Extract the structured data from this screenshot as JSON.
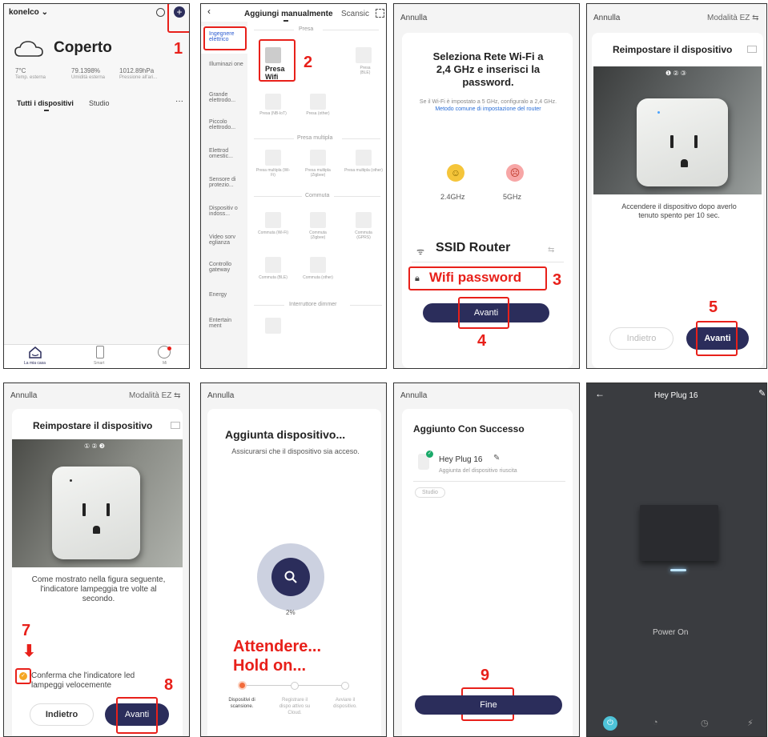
{
  "p1": {
    "user": "konelco ⌄",
    "weather": "Coperto",
    "temp": "7°C",
    "temp_lbl": "Temp. esterna",
    "hum": "79.1398%",
    "hum_lbl": "Umidità esterna",
    "press": "1012.89hPa",
    "press_lbl": "Pressione all'ari...",
    "tab_all": "Tutti i dispositivi",
    "tab_studio": "Studio",
    "more": "···",
    "nav": [
      "La mia casa",
      "Smart",
      "Mi"
    ],
    "step": "1"
  },
  "p2": {
    "title": "Aggiungi manualmente",
    "scan": "Scansic",
    "cats": [
      "Ingegnere elettrico",
      "Illuminazi one",
      "Grande elettrodo...",
      "Piccolo elettrodo...",
      "Elettrod omestic...",
      "Sensore di protezio...",
      "Dispositiv o indoss...",
      "Video sorv eglianza",
      "Controllo gateway",
      "Energy",
      "Entertain ment"
    ],
    "sec_presa": "Presa",
    "presa_wifi": "Presa Wifi",
    "presa_ble": "Presa (BLE)",
    "presa_nbiot": "Presa (NB-IoT)",
    "presa_other": "Presa (other)",
    "sec_multi": "Presa multipla",
    "multi": [
      "Presa multipla (Wi-Fi)",
      "Presa multipla (Zigbee)",
      "Presa multipla (other)"
    ],
    "sec_commuta": "Commuta",
    "commuta": [
      "Commuta (Wi-Fi)",
      "Commuta (Zigbee)",
      "Commuta (GPRS)",
      "Commuta (BLE)",
      "Commuta (other)"
    ],
    "sec_dimmer": "Interruttore dimmer",
    "step": "2"
  },
  "p3": {
    "cancel": "Annulla",
    "title": "Seleziona Rete Wi-Fi a 2,4 GHz e inserisci la password.",
    "desc": "Se il Wi-Fi è impostato a 5 GHz, configuralo a 2,4 GHz.",
    "link": "Metodo comune di impostazione del router",
    "g24": "2.4GHz",
    "g5": "5GHz",
    "ssid": "SSID Router",
    "pwd": "Wifi password",
    "next": "Avanti",
    "step3": "3",
    "step4": "4"
  },
  "p4": {
    "cancel": "Annulla",
    "mode": "Modalità EZ ⇆",
    "title": "Reimpostare il dispositivo",
    "steps": "❶ ② ③",
    "text": "Accendere il dispositivo dopo averlo tenuto spento per 10 sec.",
    "back": "Indietro",
    "next": "Avanti",
    "step": "5"
  },
  "p5": {
    "cancel": "Annulla",
    "mode": "Modalità EZ ⇆",
    "title": "Reimpostare il dispositivo",
    "steps": "① ② ❸",
    "text": "Come mostrato nella figura seguente, l'indicatore lampeggia tre volte al secondo.",
    "confirm": "Conferma che l'indicatore led lampeggi velocemente",
    "back": "Indietro",
    "next": "Avanti",
    "step7": "7",
    "step8": "8"
  },
  "p6": {
    "cancel": "Annulla",
    "title": "Aggiunta dispositivo...",
    "sub": "Assicurarsi che il dispositivo sia acceso.",
    "pct": "2%",
    "wait1": "Attendere...",
    "wait2": "Hold on...",
    "s1": "Dispositivi di scansione.",
    "s2": "Registrare il dispo attivo su Cloud.",
    "s3": "Avviare il dispositivo."
  },
  "p7": {
    "cancel": "Annulla",
    "title": "Aggiunto Con Successo",
    "name": "Hey Plug 16",
    "sub": "Aggiunta del dispositivo riuscita",
    "room": "Studio",
    "done": "Fine",
    "step": "9"
  },
  "p8": {
    "title": "Hey Plug 16",
    "status": "Power On"
  }
}
